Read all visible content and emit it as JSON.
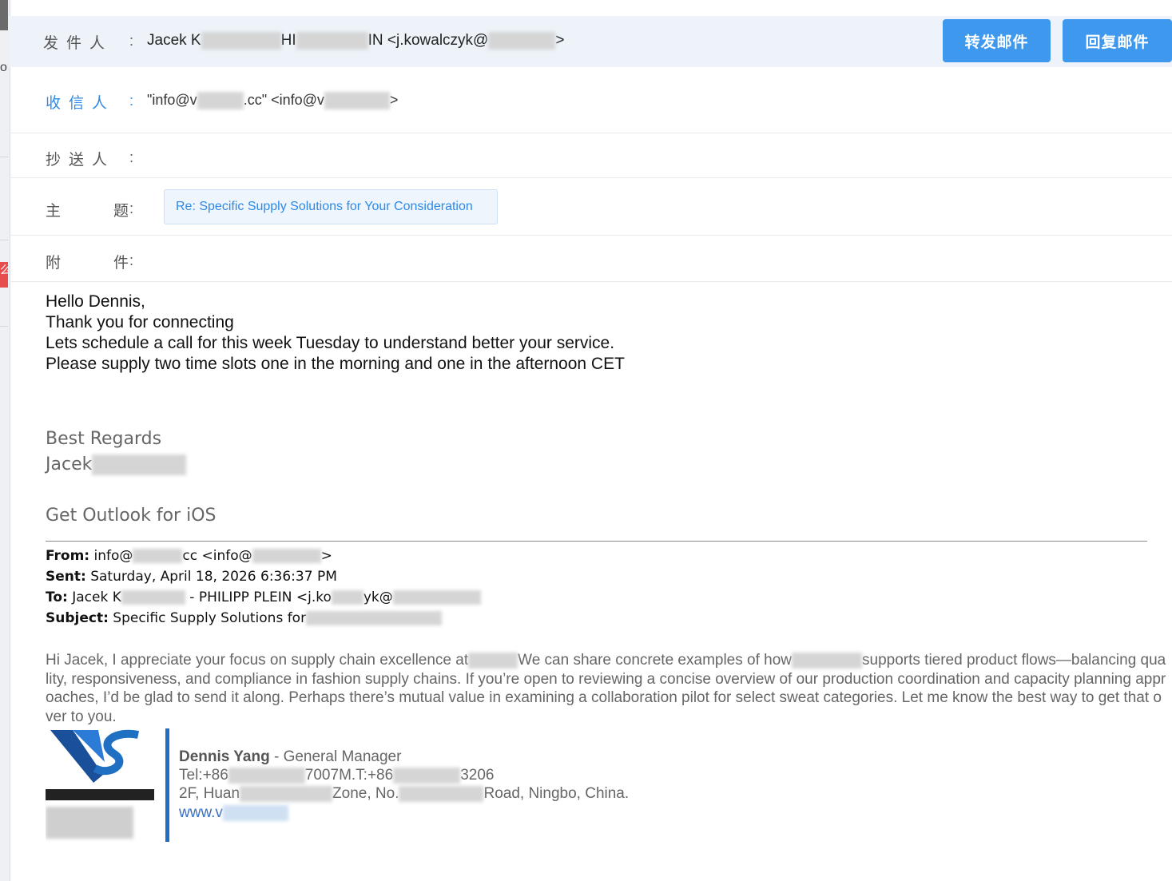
{
  "header": {
    "from_label": "发件人",
    "from_value_a": "Jacek K",
    "from_value_b": "HI",
    "from_value_c": "IN <j.kowalczyk@",
    "from_value_d": ">",
    "forward_button": "转发邮件",
    "reply_button": "回复邮件",
    "to_label": "收信人",
    "to_value_a": "\"info@v",
    "to_value_b": ".cc\" <info@v",
    "to_value_c": ">",
    "cc_label": "抄送人",
    "subject_label": "主 题",
    "subject_value": "Re: Specific Supply Solutions for Your Consideration",
    "attach_label": "附 件",
    "colon": ":"
  },
  "body": {
    "lines": [
      "Hello Dennis,",
      "Thank you for connecting",
      "Lets schedule a call for this week Tuesday to understand better your  service.",
      "Please supply two time slots one in the morning and one in the afternoon CET"
    ],
    "regards": "Best Regards",
    "signer": "Jacek",
    "outlook": "Get Outlook for iOS"
  },
  "quoted": {
    "from_key": "From:",
    "from_value_a": "info@",
    "from_value_b": "cc <info@",
    "from_value_c": ">",
    "sent_key": "Sent:",
    "sent_value": "Saturday, April 18, 2026 6:36:37 PM",
    "to_key": "To:",
    "to_value_a": "Jacek K",
    "to_value_b": "- PHILIPP PLEIN <j.ko",
    "to_value_c": "yk@",
    "subject_key": "Subject:",
    "subject_value": "Specific Supply Solutions for",
    "para_a": "Hi Jacek, I appreciate your focus on supply chain excellence at",
    "para_b": "We can share concrete examples of how",
    "para_c": "supports tiered product flows—balancing quality, responsiveness, and compliance in fashion supply chains. If you’re open to reviewing a concise overview of our production coordination and capacity planning approaches, I’d be glad to send it along. Perhaps there’s mutual value in examining a collaboration pilot for select sweat categories. Let me know the best way to get that over to you."
  },
  "signature": {
    "name": "Dennis Yang",
    "title": " - General Manager",
    "tel_a": "Tel:+86",
    "tel_b": "7007M.T:+86",
    "tel_c": "3206",
    "addr_a": "2F, Huan",
    "addr_b": "Zone, No.",
    "addr_c": "Road, Ningbo, China.",
    "web": "www.v",
    "logo_brand": "VS"
  },
  "colors": {
    "accent": "#3e99ee",
    "link_blue": "#2e8ae6",
    "header_bg": "#edf3f9",
    "logo_blue": "#1f6fc2"
  }
}
